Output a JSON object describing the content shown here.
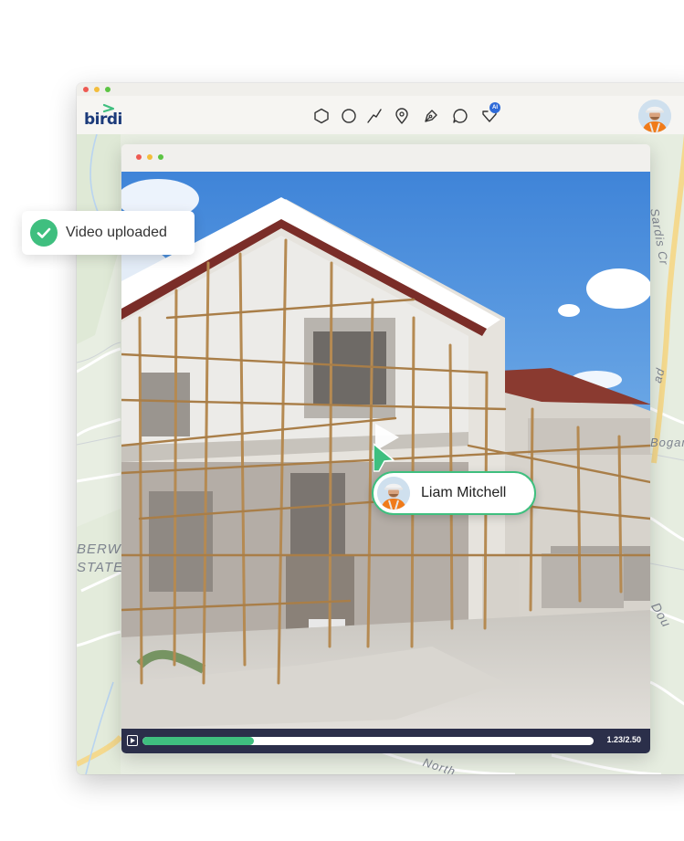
{
  "app": {
    "logo_text": "birdi",
    "window_controls": [
      "close",
      "minimize",
      "maximize"
    ],
    "toolbar_tools": [
      {
        "icon": "polygon-icon"
      },
      {
        "icon": "circle-icon"
      },
      {
        "icon": "line-icon"
      },
      {
        "icon": "location-pin-icon"
      },
      {
        "icon": "pen-tool-icon"
      },
      {
        "icon": "comment-icon"
      },
      {
        "icon": "ai-shield-icon",
        "badge": "AI"
      }
    ],
    "accent_color": "#3fbf7f",
    "brand_color": "#1b3a7a"
  },
  "map": {
    "labels": [
      "Sardis Cr",
      "Bogan",
      "BERW",
      "STATE",
      "Dou",
      "ad",
      "North"
    ]
  },
  "toast": {
    "text": "Video uploaded",
    "icon": "check-circle-icon"
  },
  "collaborator": {
    "name": "Liam Mitchell",
    "cursor_icon": "pointer-cursor-icon"
  },
  "video": {
    "time_display": "1.23/2.50",
    "progress_fraction": 0.246
  }
}
